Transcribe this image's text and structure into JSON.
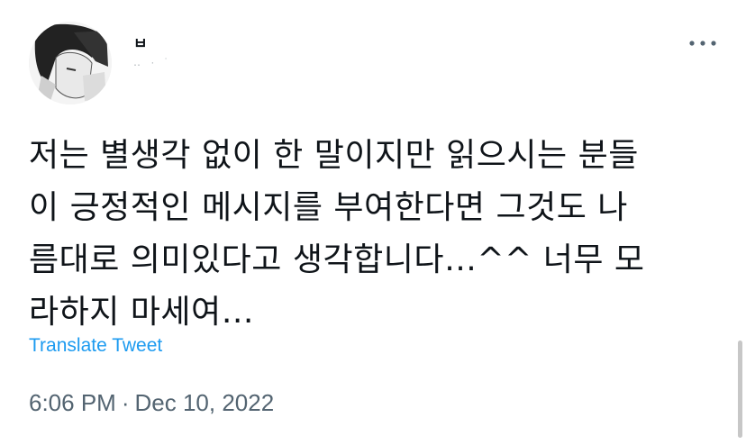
{
  "author": {
    "display_name": "ㅂ",
    "handle": "‥  ·  ˙"
  },
  "more_icon": "more-horizontal-icon",
  "tweet": {
    "lines": [
      "저는 별생각 없이 한 말이지만 읽으시는 분들",
      "이 긍정적인 메시지를 부여한다면 그것도 나",
      "름대로 의미있다고 생각합니다…^^ 너무 모",
      "라하지 마세여…"
    ]
  },
  "translate_label": "Translate Tweet",
  "timestamp": {
    "time": "6:06 PM",
    "separator": "·",
    "date": "Dec 10, 2022"
  },
  "colors": {
    "text": "#0f1419",
    "link": "#1d9bf0",
    "meta": "#536471"
  }
}
